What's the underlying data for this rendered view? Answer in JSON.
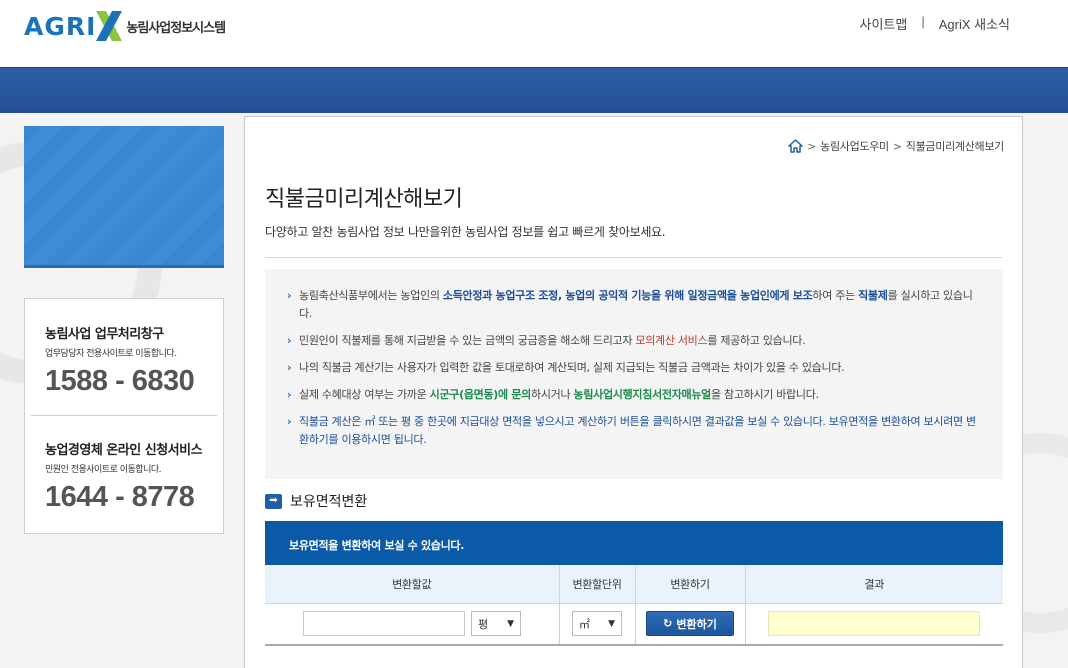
{
  "header": {
    "logo_text": "AGRIX",
    "logo_subtitle": "농림사업정보시스템",
    "links": [
      "사이트맵",
      "AgriX 새소식"
    ],
    "link_separator": "|"
  },
  "sidebar": {
    "contacts": [
      {
        "title": "농림사업 업무처리창구",
        "subtitle": "업무담당자 전용사이트로 이동합니다.",
        "phone": "1588 - 6830"
      },
      {
        "title": "농업경영체 온라인 신청서비스",
        "subtitle": "민원인 전용사이트로 이동합니다.",
        "phone": "1644 - 8778"
      }
    ]
  },
  "breadcrumb": {
    "items": [
      "농림사업도우미",
      "직불금미리계산해보기"
    ],
    "separator": ">"
  },
  "page": {
    "title": "직불금미리계산해보기",
    "description": "다양하고 알찬 농림사업 정보 나만을위한 농림사업 정보를 쉽고 빠르게 찾아보세요."
  },
  "notice": {
    "items": [
      {
        "parts": [
          {
            "text": "농림축산식품부에서는 농업인의 ",
            "style": "plain"
          },
          {
            "text": "소득안정과 농업구조 조정, 농업의 공익적 기능을 위해 일정금액을 농업인에게 보조",
            "style": "blue"
          },
          {
            "text": "하여 주는 ",
            "style": "plain"
          },
          {
            "text": "직불제",
            "style": "blue"
          },
          {
            "text": "를 실시하고 있습니다.",
            "style": "plain"
          }
        ]
      },
      {
        "parts": [
          {
            "text": "민원인이 직불제를 통해 지급받을 수 있는 금액의 궁금증을 해소해 드리고자 ",
            "style": "plain"
          },
          {
            "text": "모의계산 서비스",
            "style": "red"
          },
          {
            "text": "를 제공하고 있습니다.",
            "style": "plain"
          }
        ]
      },
      {
        "parts": [
          {
            "text": "나의 직불금 계산기는 사용자가 입력한 값을 토대로하여 계산되며, 실제 지급되는 직불금 금액과는 차이가 있을 수 있습니다.",
            "style": "plain"
          }
        ]
      },
      {
        "parts": [
          {
            "text": "실제 수혜대상 여부는 가까운 ",
            "style": "plain"
          },
          {
            "text": "시군구(읍면동)에 문의",
            "style": "green"
          },
          {
            "text": "하시거나 ",
            "style": "plain"
          },
          {
            "text": "농림사업시행지침서전자매뉴얼",
            "style": "green"
          },
          {
            "text": "을 참고하시기 바랍니다.",
            "style": "plain"
          }
        ]
      },
      {
        "parts": [
          {
            "text": "직불금 계산은 ㎡ 또는 평 중 한곳에 지급대상 면적을 넣으시고 계산하기 버튼을 클릭하시면 결과값을 보실 수 있습니다. 보유면적을 변환하여 보시려면 변환하기를 이용하시면 됩니다.",
            "style": "blue-plain"
          }
        ]
      }
    ]
  },
  "converter": {
    "section_title": "보유면적변환",
    "bar_text": "보유면적을 변환하여 보실 수 있습니다.",
    "columns": [
      "변환할값",
      "변환할단위",
      "변환하기",
      "결과"
    ],
    "input_value": "",
    "unit_from": "평",
    "unit_to": "㎡",
    "button_label": "변환하기",
    "result_value": ""
  },
  "colors": {
    "banner": "#2b5ca3",
    "table_bar": "#0b5aa8",
    "result_bg": "#ffffd1"
  }
}
